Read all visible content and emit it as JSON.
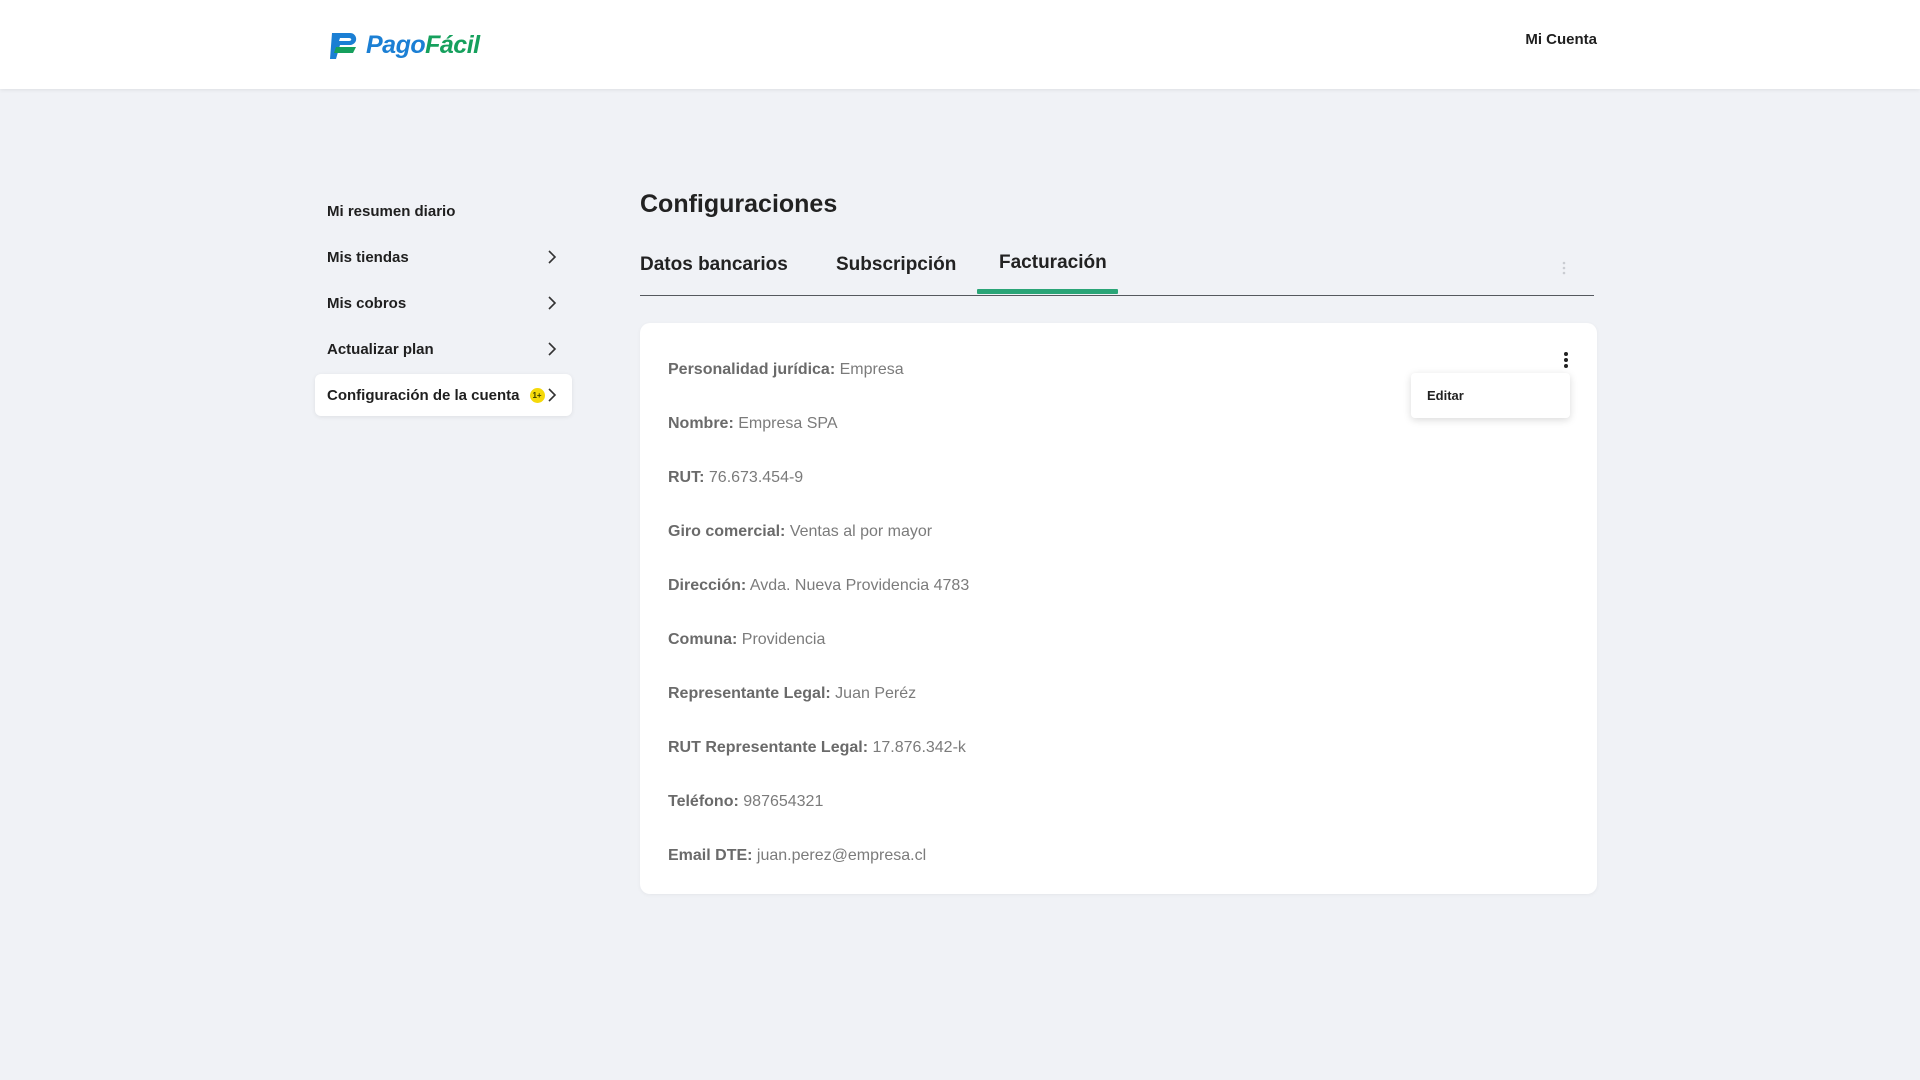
{
  "header": {
    "logo_part1": "Pago",
    "logo_part2": "Fácil",
    "account_label": "Mi Cuenta"
  },
  "sidebar": {
    "items": [
      {
        "label": "Mi resumen diario",
        "has_chevron": false
      },
      {
        "label": "Mis tiendas",
        "has_chevron": true
      },
      {
        "label": "Mis cobros",
        "has_chevron": true
      },
      {
        "label": "Actualizar plan",
        "has_chevron": true
      },
      {
        "label": "Configuración de la cuenta",
        "has_chevron": true,
        "active": true,
        "badge": "1+"
      }
    ]
  },
  "page": {
    "title": "Configuraciones",
    "tabs": [
      {
        "label": "Datos bancarios"
      },
      {
        "label": "Subscripción"
      },
      {
        "label": "Facturación",
        "active": true
      }
    ]
  },
  "card": {
    "menu_item": "Editar",
    "fields": [
      {
        "label": "Personalidad jurídica:",
        "value": "Empresa"
      },
      {
        "label": "Nombre:",
        "value": "Empresa SPA"
      },
      {
        "label": "RUT:",
        "value": "76.673.454-9"
      },
      {
        "label": "Giro comercial:",
        "value": "Ventas al por mayor"
      },
      {
        "label": "Dirección:",
        "value": "Avda. Nueva Providencia 4783"
      },
      {
        "label": "Comuna:",
        "value": "Providencia"
      },
      {
        "label": "Representante Legal:",
        "value": "Juan Peréz"
      },
      {
        "label": "RUT Representante Legal:",
        "value": "17.876.342-k"
      },
      {
        "label": "Teléfono:",
        "value": "987654321"
      },
      {
        "label": "Email DTE:",
        "value": "juan.perez@empresa.cl"
      }
    ]
  },
  "colors": {
    "accent_green": "#2aa577",
    "logo_blue": "#1b7fd4",
    "logo_green": "#16a05d",
    "badge_yellow": "#f5d90a",
    "background": "#f0f2f6"
  }
}
